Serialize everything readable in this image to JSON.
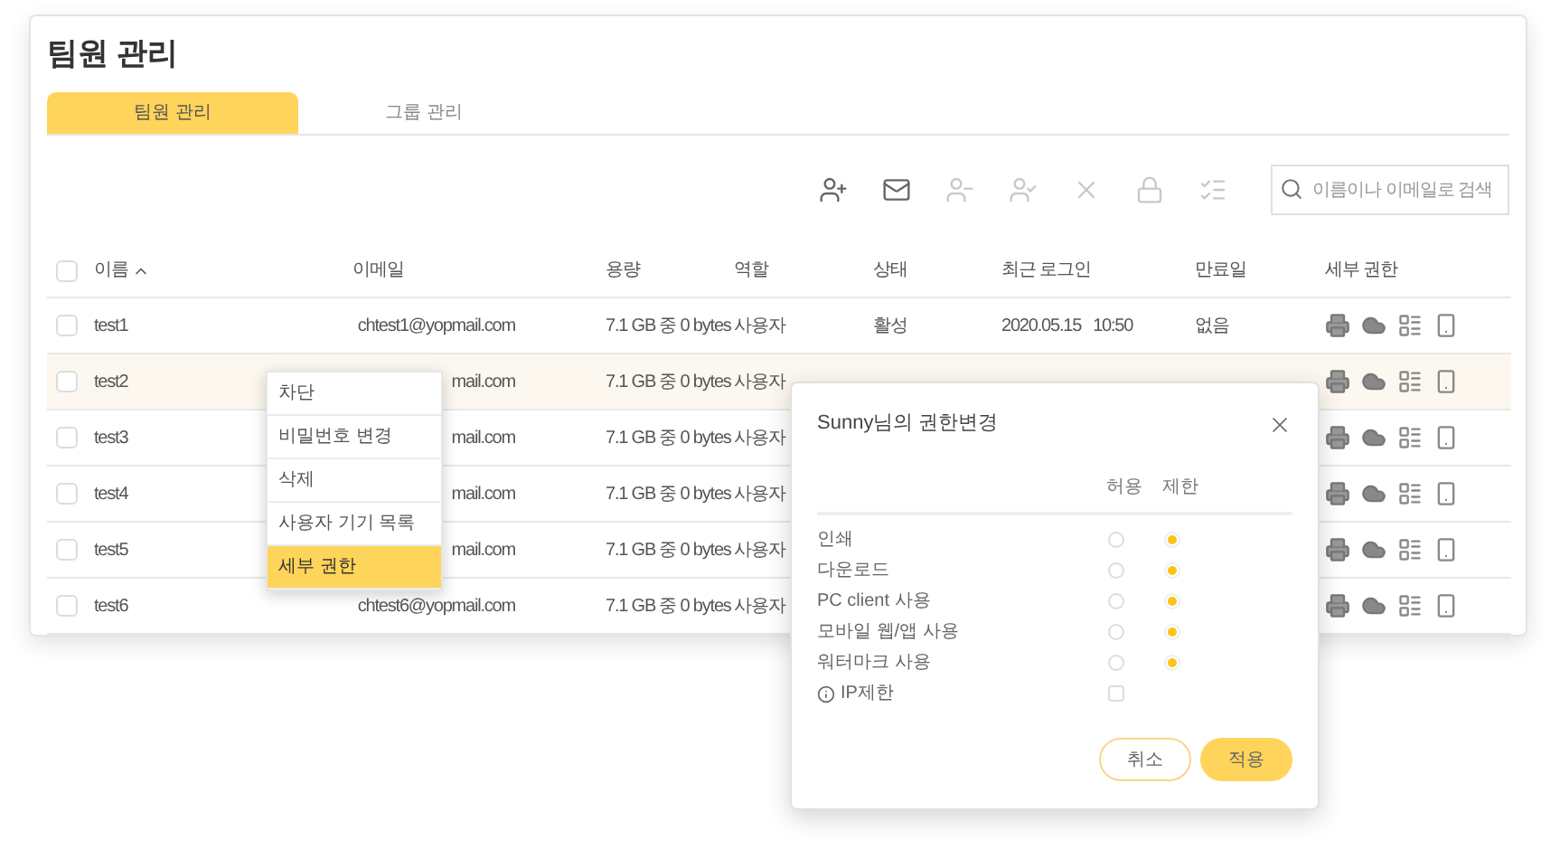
{
  "page_title": "팀원 관리",
  "tabs": [
    {
      "label": "팀원 관리",
      "selected": true
    },
    {
      "label": "그룹 관리",
      "selected": false
    }
  ],
  "toolbar": [
    {
      "kind": "add-user",
      "disabled": false
    },
    {
      "kind": "mail",
      "disabled": false
    },
    {
      "kind": "remove-user",
      "disabled": true
    },
    {
      "kind": "check-user",
      "disabled": true
    },
    {
      "kind": "close",
      "disabled": true
    },
    {
      "kind": "lock",
      "disabled": true
    },
    {
      "kind": "list",
      "disabled": true
    }
  ],
  "search": {
    "placeholder": "이름이나 이메일로 검색"
  },
  "table": {
    "all_checked": false,
    "columns": [
      "이름",
      "이메일",
      "용량",
      "역할",
      "상태",
      "최근 로그인",
      "만료일",
      "세부 권한"
    ],
    "rows": [
      {
        "name": "test1",
        "email": "chtest1@yopmail.com",
        "size": "7.1 GB 중 0 bytes",
        "role": "사용자",
        "status": "활성",
        "last_login": "2020.05.15   10:50",
        "expiry": "없음",
        "highlighted": false,
        "checked": false
      },
      {
        "name": "test2",
        "email": "mail.com",
        "size": "7.1 GB 중 0 bytes",
        "role": "사용자",
        "highlighted": true,
        "checked": false
      },
      {
        "name": "test3",
        "email": "mail.com",
        "size": "7.1 GB 중 0 bytes",
        "role": "사용자",
        "highlighted": false,
        "checked": false
      },
      {
        "name": "test4",
        "email": "mail.com",
        "size": "7.1 GB 중 0 bytes",
        "role": "사용자",
        "highlighted": false,
        "checked": false
      },
      {
        "name": "test5",
        "email": "mail.com",
        "size": "7.1 GB 중 0 bytes",
        "role": "사용자",
        "highlighted": false,
        "checked": false
      },
      {
        "name": "test6",
        "email": "chtest6@yopmail.com",
        "size": "7.1 GB 중 0 bytes",
        "role": "사용자",
        "highlighted": false,
        "checked": false
      }
    ]
  },
  "context_menu": [
    {
      "label": "차단",
      "selected": false
    },
    {
      "label": "비밀번호 변경",
      "selected": false
    },
    {
      "label": "삭제",
      "selected": false
    },
    {
      "label": "사용자 기기 목록",
      "selected": false
    },
    {
      "label": "세부 권한",
      "selected": true
    }
  ],
  "dialog": {
    "title": "Sunny님의 권한변경",
    "columns": [
      "허용",
      "제한"
    ],
    "items": [
      {
        "kind": "radio",
        "label": "인쇄",
        "allow_selected": false,
        "restrict_selected": true
      },
      {
        "kind": "radio",
        "label": "다운로드",
        "allow_selected": false,
        "restrict_selected": true
      },
      {
        "kind": "radio",
        "label": "PC client 사용",
        "allow_selected": false,
        "restrict_selected": true
      },
      {
        "kind": "radio",
        "label": "모바일 웹/앱 사용",
        "allow_selected": false,
        "restrict_selected": true
      },
      {
        "kind": "radio",
        "label": "워터마크 사용",
        "allow_selected": false,
        "restrict_selected": true
      },
      {
        "kind": "checkbox",
        "label": "IP제한",
        "checked": false
      }
    ],
    "buttons": [
      "취소",
      "적용"
    ]
  }
}
